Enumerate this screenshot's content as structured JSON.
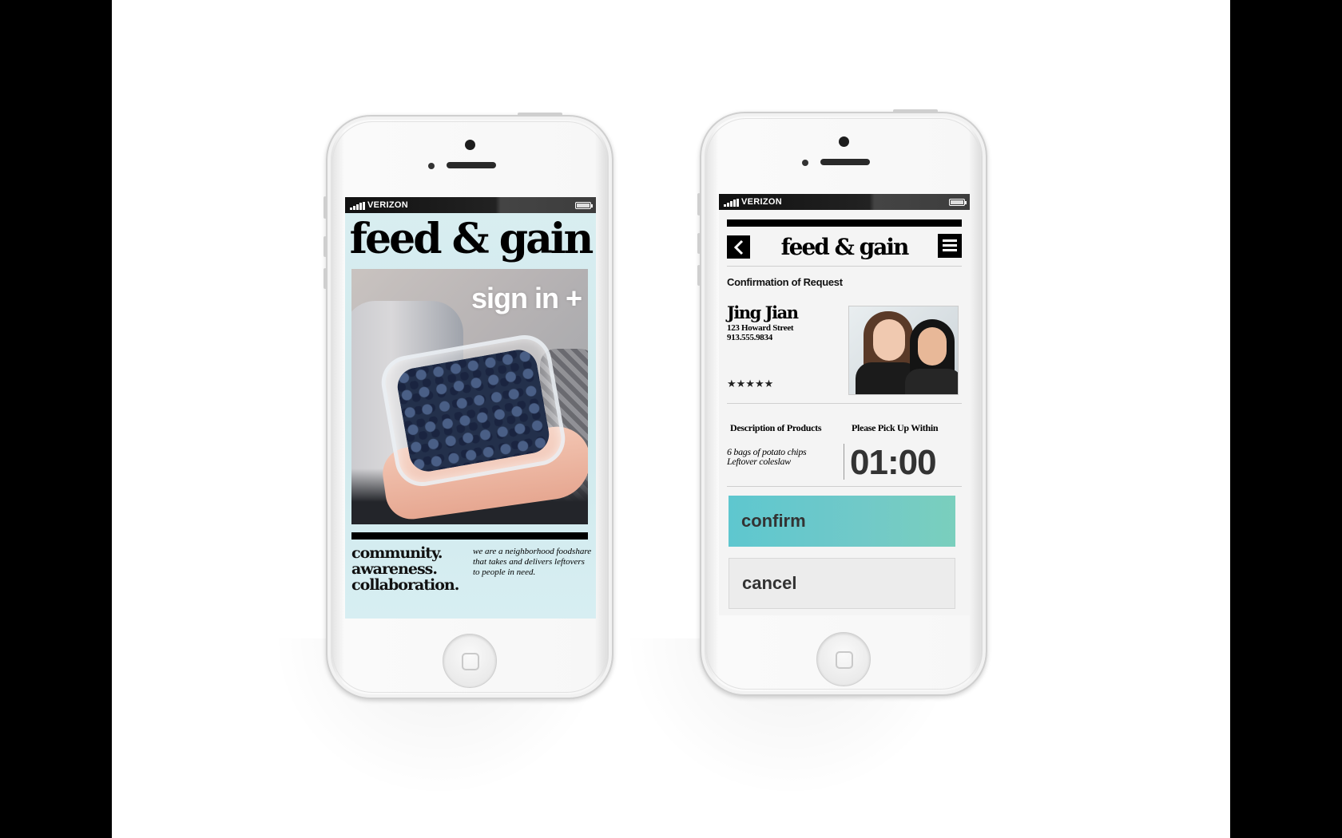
{
  "status_bar": {
    "carrier": "VERIZON"
  },
  "signin_screen": {
    "brand": "feed & gain",
    "signin_label": "sign in +",
    "motto": [
      "community.",
      "awareness.",
      "collaboration."
    ],
    "blurb": "we are a neighborhood foodshare that takes and delivers leftovers to people in need."
  },
  "confirm_screen": {
    "brand": "feed & gain",
    "title": "Confirmation of Request",
    "person": {
      "name": "Jing Jian",
      "address": "123 Howard Street",
      "phone": "913.555.9834",
      "rating_stars": "★★★★★",
      "rating": 5
    },
    "description_header": "Description of Products",
    "pickup_header": "Please Pick Up Within",
    "products": [
      "6 bags of potato chips",
      "Leftover coleslaw"
    ],
    "timer": "01:00",
    "confirm_label": "confirm",
    "cancel_label": "cancel"
  },
  "colors": {
    "accent_start": "#5ec7cf",
    "accent_end": "#7acfbd",
    "screen_tint": "#d9eef1"
  },
  "icons": [
    "signal-icon",
    "battery-icon",
    "back-arrow-icon",
    "menu-icon",
    "star-icon",
    "home-button-icon"
  ]
}
